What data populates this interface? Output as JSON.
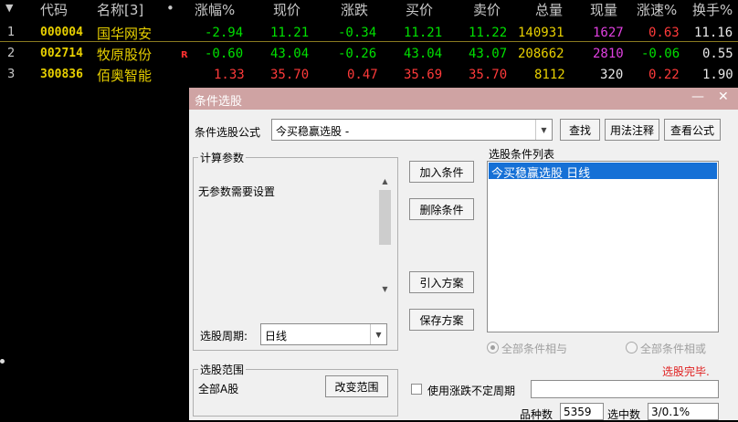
{
  "quote_table": {
    "sort_icon": "triangle-down-icon",
    "headers": {
      "code": "代码",
      "name": "名称[3]",
      "dot": "•",
      "change_pct": "涨幅%",
      "price": "现价",
      "change": "涨跌",
      "bid": "买价",
      "ask": "卖价",
      "volume": "总量",
      "last_vol": "现量",
      "speed": "涨速%",
      "turnover": "换手%"
    },
    "rows": [
      {
        "idx": "1",
        "code": "000004",
        "name": "国华网安",
        "flag": "",
        "change_pct": "-2.94",
        "price": "11.21",
        "change": "-0.34",
        "bid": "11.21",
        "ask": "11.22",
        "volume": "140931",
        "last_vol": "1627",
        "speed": "0.63",
        "turnover": "11.16"
      },
      {
        "idx": "2",
        "code": "002714",
        "name": "牧原股份",
        "flag": "R",
        "change_pct": "-0.60",
        "price": "43.04",
        "change": "-0.26",
        "bid": "43.04",
        "ask": "43.07",
        "volume": "208662",
        "last_vol": "2810",
        "speed": "-0.06",
        "turnover": "0.55"
      },
      {
        "idx": "3",
        "code": "300836",
        "name": "佰奥智能",
        "flag": "",
        "change_pct": "1.33",
        "price": "35.70",
        "change": "0.47",
        "bid": "35.69",
        "ask": "35.70",
        "volume": "8112",
        "last_vol": "320",
        "speed": "0.22",
        "turnover": "1.90"
      }
    ]
  },
  "dialog": {
    "title": "条件选股",
    "minimize": "—",
    "close": "✕",
    "formula_label": "条件选股公式",
    "formula_value": "今买稳赢选股 -",
    "find_btn": "查找",
    "usage_btn": "用法注释",
    "view_btn": "查看公式",
    "params_group": "计算参数",
    "params_text": "无参数需要设置",
    "period_label": "选股周期:",
    "period_value": "日线",
    "add_btn": "加入条件",
    "delete_btn": "删除条件",
    "import_btn": "引入方案",
    "save_btn": "保存方案",
    "conditions_label": "选股条件列表",
    "conditions": [
      "今买稳赢选股  日线"
    ],
    "radio_and": "全部条件相与",
    "radio_or": "全部条件相或",
    "status": "选股完毕.",
    "range_group": "选股范围",
    "range_value": "全部A股",
    "range_btn": "改变范围",
    "uncertain_period": "使用涨跌不定周期",
    "count_label": "品种数",
    "count_value": "5359",
    "selected_label": "选中数",
    "selected_value": "3/0.1%"
  }
}
